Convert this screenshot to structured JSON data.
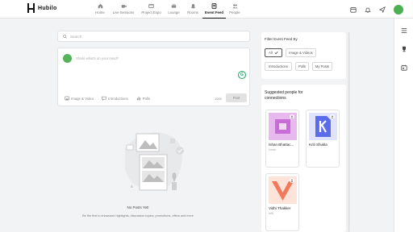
{
  "app": {
    "logo_text": "Hubilo"
  },
  "nav": {
    "items": [
      {
        "label": "Home",
        "icon": "home-icon"
      },
      {
        "label": "Live Sessions",
        "icon": "video-icon"
      },
      {
        "label": "Project Expo",
        "icon": "expo-icon"
      },
      {
        "label": "Lounge",
        "icon": "lounge-icon"
      },
      {
        "label": "Rooms",
        "icon": "rooms-icon"
      },
      {
        "label": "Event Feed",
        "icon": "feed-icon",
        "active": true
      },
      {
        "label": "People",
        "icon": "people-icon"
      }
    ]
  },
  "search": {
    "placeholder": "Search"
  },
  "composer": {
    "placeholder": "Share what's on your mind?",
    "grammarly": "G",
    "tools": [
      {
        "label": "Image & Video",
        "icon": "image-icon"
      },
      {
        "label": "Introductions",
        "icon": "chat-icon"
      },
      {
        "label": "Polls",
        "icon": "poll-icon"
      }
    ],
    "char_count": "1000",
    "post_label": "Post"
  },
  "empty_state": {
    "title": "No Posts Yet!",
    "subtitle": "Be the first to showcase highlights, discussion topics, promotions, offers and more"
  },
  "filter": {
    "title": "Filter Event Feed By",
    "chips": [
      {
        "label": "All",
        "selected": true
      },
      {
        "label": "Image & Videos"
      },
      {
        "label": "Introductions"
      },
      {
        "label": "Polls"
      },
      {
        "label": "My Posts"
      }
    ]
  },
  "suggestions": {
    "title": "Suggested people for connections",
    "people": [
      {
        "name": "Ishan Bhattac...",
        "subtitle": "Lmoe",
        "color": "#c86dd7"
      },
      {
        "name": "Kriti Shukla",
        "subtitle": "",
        "color": "#5b6bea"
      },
      {
        "name": "Vidhi Thakker",
        "subtitle": "Inifi",
        "color": "#f07a5a"
      }
    ]
  },
  "colors": {
    "accent": "#111111",
    "avatar_green": "#4caf50",
    "grammarly_green": "#1aa260"
  }
}
